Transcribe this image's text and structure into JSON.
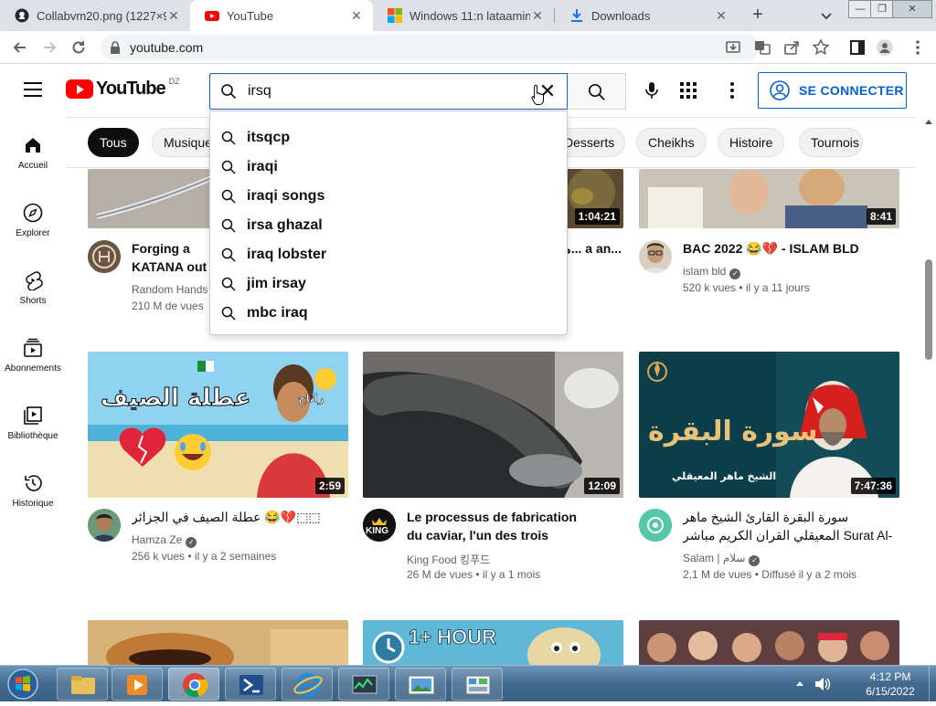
{
  "browser": {
    "tabs": [
      {
        "title": "Collabvm20.png (1227×9"
      },
      {
        "title": "YouTube"
      },
      {
        "title": "Windows 11:n lataaminen"
      },
      {
        "title": "Downloads"
      }
    ],
    "new_tab": "+",
    "close_glyph": "✕",
    "window_controls": [
      "—",
      "❐",
      "✕"
    ],
    "url": "youtube.com"
  },
  "youtube": {
    "logo_text": "YouTube",
    "country_code": "DZ",
    "search": {
      "value": "irsq",
      "clear": "✕"
    },
    "signin_label": "SE CONNECTER",
    "suggestions": [
      "itsqcp",
      "iraqi",
      "iraqi songs",
      "irsa ghazal",
      "iraq lobster",
      "jim irsay",
      "mbc iraq"
    ],
    "chips": [
      "Tous",
      "Musique",
      "Desserts",
      "Cheikhs",
      "Histoire",
      "Tournois"
    ],
    "sidebar": [
      {
        "label": "Accueil",
        "icon": "home-icon"
      },
      {
        "label": "Explorer",
        "icon": "compass-icon"
      },
      {
        "label": "Shorts",
        "icon": "shorts-icon"
      },
      {
        "label": "Abonnements",
        "icon": "subscriptions-icon"
      },
      {
        "label": "Bibliothèque",
        "icon": "library-icon"
      },
      {
        "label": "Historique",
        "icon": "history-icon"
      }
    ],
    "videos": [
      {
        "title": "Forging a KATANA out of Iron CHAIN",
        "channel": "Random Hands",
        "verified": false,
        "meta": "210 M de vues",
        "duration": ""
      },
      {
        "title": "ماشا والد... a an...",
        "channel": "",
        "verified": false,
        "meta": "",
        "duration": "1:04:21"
      },
      {
        "title": "BAC 2022 😂💔 - ISLAM BLD",
        "channel": "islam bld",
        "verified": true,
        "meta": "520 k vues • il y a 11 jours",
        "duration": "8:41"
      },
      {
        "title": "عطلة الصيف في الجزائر 😂💔⬚⬚",
        "channel": "Hamza Ze",
        "verified": true,
        "meta": "256 k vues • il y a 2 semaines",
        "duration": "2:59",
        "thumb_text": "عطلة الصيف",
        "thumb_tag": "راتاح"
      },
      {
        "title": "Le processus de fabrication du caviar, l'un des trois meilleurs...",
        "channel": "King Food 킹푸드",
        "verified": false,
        "meta": "26 M de vues • il y a 1 mois",
        "duration": "12:09",
        "avatar_text": "KING"
      },
      {
        "title": "سورة البقرة القارئ الشيخ ماهر المعيقلي القران الكريم مباشر Surat Al-Baqarah Qura...",
        "channel": "Salam | سلام",
        "verified": true,
        "meta": "2,1 M de vues • Diffusé il y a 2 mois",
        "duration": "7:47:36",
        "thumb_text": "سورة البقرة",
        "thumb_sub": "الشيخ ماهر المعيقلي"
      },
      {
        "thumb_text": "1+ HOUR"
      }
    ]
  },
  "taskbar": {
    "time": "4:12 PM",
    "date": "6/15/2022"
  }
}
